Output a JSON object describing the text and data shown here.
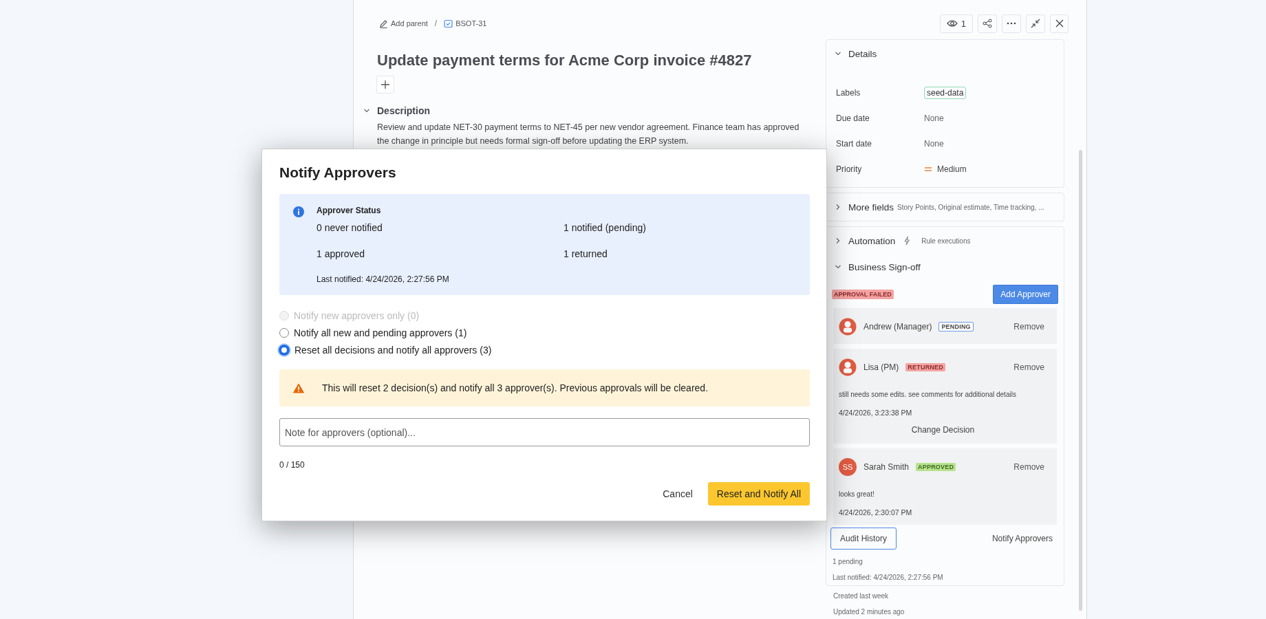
{
  "breadcrumb": {
    "add_parent": "Add parent",
    "separator": "/",
    "issue_key": "BSOT-31"
  },
  "header_actions": {
    "watchers": "1"
  },
  "title": "Update payment terms for Acme Corp invoice #4827",
  "description": {
    "heading": "Description",
    "expanded": true,
    "text": "Review and update NET-30 payment terms to NET-45 per new vendor agreement. Finance team has approved the change in principle but needs formal sign-off before updating the ERP system."
  },
  "details": {
    "heading": "Details",
    "expanded": true,
    "fields": [
      {
        "label": "Labels",
        "value": "seed-data",
        "kind": "tag"
      },
      {
        "label": "Due date",
        "value": "None",
        "kind": "text"
      },
      {
        "label": "Start date",
        "value": "None",
        "kind": "text"
      },
      {
        "label": "Priority",
        "value": "Medium",
        "kind": "priority"
      }
    ]
  },
  "more_fields": {
    "heading": "More fields",
    "hint": "Story Points, Original estimate, Time tracking, ...",
    "expanded": false
  },
  "automation": {
    "heading": "Automation",
    "hint": "Rule executions",
    "expanded": false
  },
  "sign_off": {
    "heading": "Business Sign-off",
    "expanded": true,
    "status_badge": "APPROVAL FAILED",
    "add_button": "Add Approver",
    "approvers": [
      {
        "name": "Andrew (Manager)",
        "kind": "icon",
        "badge": {
          "text": "PENDING",
          "kind": "pending"
        },
        "remove": "Remove"
      },
      {
        "name": "Lisa (PM)",
        "kind": "icon",
        "badge": {
          "text": "RETURNED",
          "kind": "returned"
        },
        "remove": "Remove",
        "comment": "still needs some edits. see comments for additional details",
        "time": "4/24/2026, 3:23:38 PM",
        "change_button": "Change Decision"
      },
      {
        "name": "Sarah Smith",
        "kind": "initials",
        "initials": "SS",
        "badge": {
          "text": "APPROVED",
          "kind": "approved"
        },
        "remove": "Remove",
        "comment": "looks great!",
        "time": "4/24/2026, 2:30:07 PM"
      }
    ],
    "audit_button": "Audit History",
    "notify_button": "Notify Approvers",
    "pending": "1 pending",
    "last_notified": "Last notified: 4/24/2026, 2:27:56 PM"
  },
  "footer": {
    "created": "Created last week",
    "updated": "Updated 2 minutes ago"
  },
  "modal": {
    "title": "Notify Approvers",
    "status": {
      "heading": "Approver Status",
      "counts": [
        "0 never notified",
        "1 notified (pending)",
        "1 approved",
        "1 returned"
      ],
      "last_notified": "Last notified: 4/24/2026, 2:27:56 PM"
    },
    "options": [
      {
        "label": "Notify new approvers only (0)",
        "disabled": true,
        "selected": false
      },
      {
        "label": "Notify all new and pending approvers (1)",
        "disabled": false,
        "selected": false
      },
      {
        "label": "Reset all decisions and notify all approvers (3)",
        "disabled": false,
        "selected": true
      }
    ],
    "warning": "This will reset 2 decision(s) and notify all 3 approver(s). Previous approvals will be cleared.",
    "note_placeholder": "Note for approvers (optional)...",
    "counter": "0 / 150",
    "cancel": "Cancel",
    "confirm": "Reset and Notify All"
  }
}
